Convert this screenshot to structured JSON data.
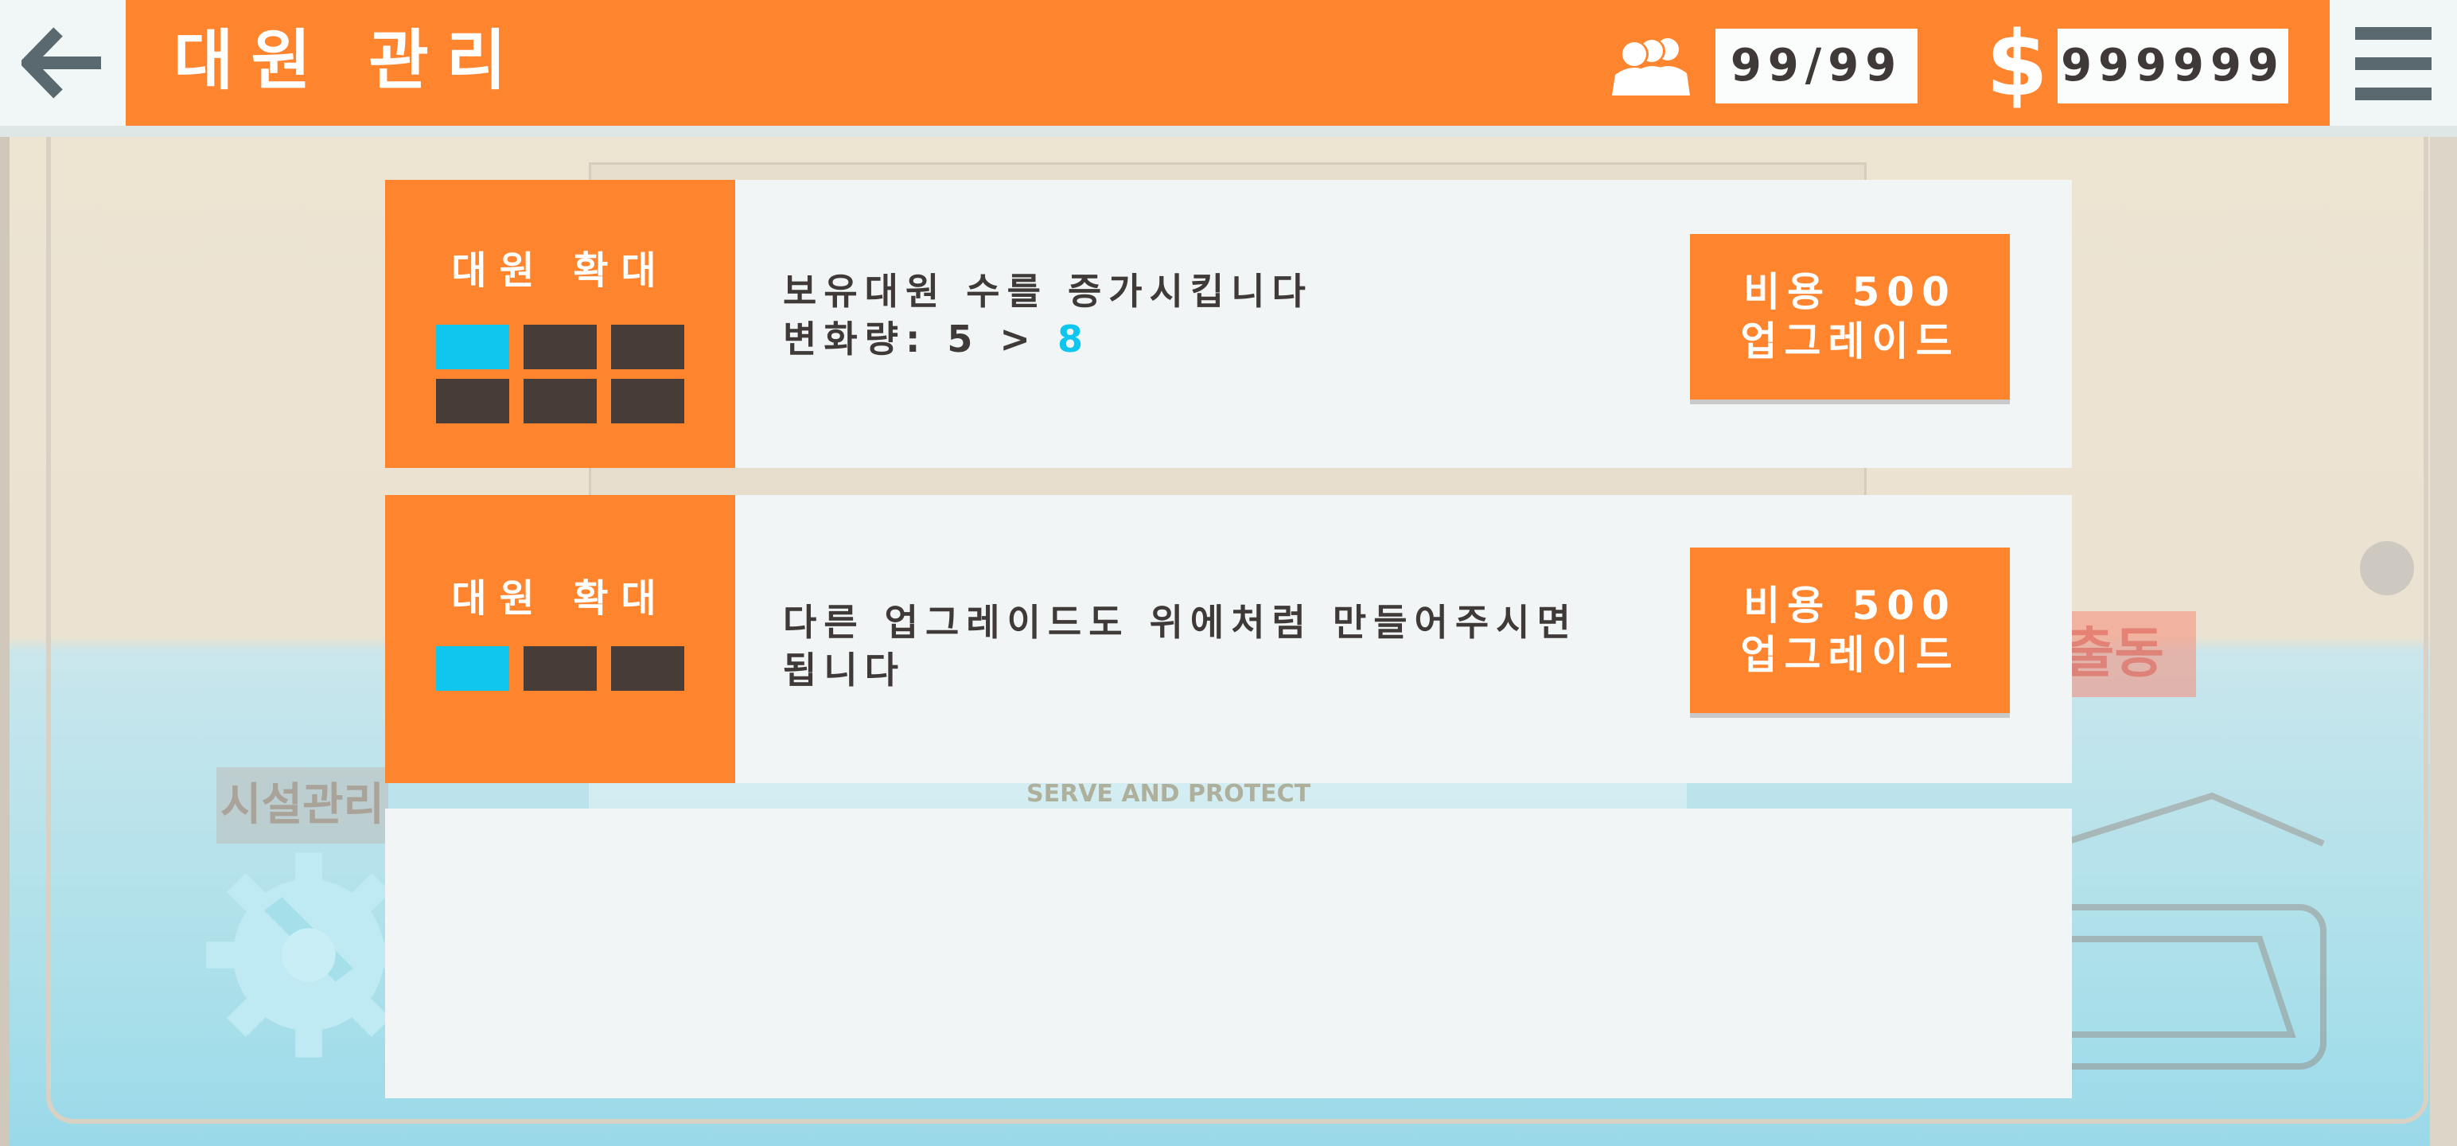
{
  "header": {
    "title": "대원 관리",
    "crew_count": "99/99",
    "money_symbol": "$",
    "money": "999999",
    "icons": {
      "back": "back-arrow-icon",
      "crew": "crew-icon",
      "money": "dollar-icon",
      "menu": "hamburger-menu-icon"
    }
  },
  "background": {
    "facility_label": "시설관리",
    "dispatch_label": "출동",
    "serve_text": "SERVE AND PROTECT"
  },
  "upgrades": [
    {
      "title": "대원 확대",
      "level": 1,
      "max_level": 6,
      "desc_line1": "보유대원 수를 증가시킵니다",
      "desc_line2_prefix": "변화량: 5 > ",
      "desc_line2_value": "8",
      "button_line1": "비용 500",
      "button_line2": "업그레이드"
    },
    {
      "title": "대원 확대",
      "level": 1,
      "max_level": 3,
      "desc_line1": "다른 업그레이드도 위에처럼 만들어주시면",
      "desc_line2": "됩니다",
      "button_line1": "비용 500",
      "button_line2": "업그레이드"
    }
  ],
  "colors": {
    "accent": "#ff842e",
    "level_on": "#10c6ee",
    "level_off": "#473c38",
    "text_dark": "#3f3a38",
    "panel": "#f1f5f5"
  }
}
